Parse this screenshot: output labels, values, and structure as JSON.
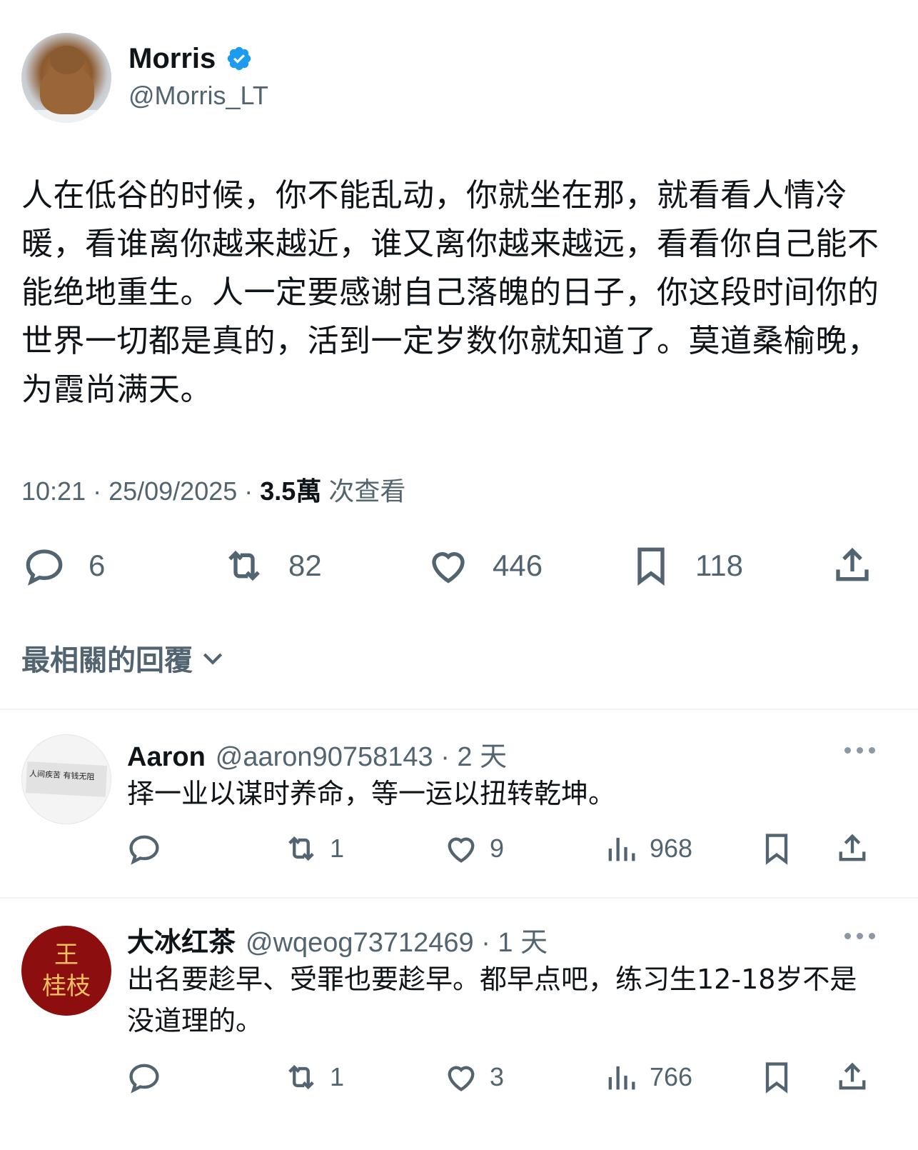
{
  "tweet": {
    "author": {
      "name": "Morris",
      "handle": "@Morris_LT",
      "verified": true
    },
    "text": "人在低谷的时候，你不能乱动，你就坐在那，就看看人情冷暖，看谁离你越来越近，谁又离你越来越远，看看你自己能不能绝地重生。人一定要感谢自己落魄的日子，你这段时间你的世界一切都是真的，活到一定岁数你就知道了。莫道桑榆晚，为霞尚满天。",
    "meta": {
      "time": "10:21",
      "sep1": " · ",
      "date": "25/09/2025",
      "sep2": " · ",
      "views_count": "3.5萬",
      "views_label": " 次查看"
    },
    "actions": {
      "replies": "6",
      "reposts": "82",
      "likes": "446",
      "bookmarks": "118"
    }
  },
  "sort_label": "最相關的回覆",
  "replies": [
    {
      "name": "Aaron",
      "handle": "@aaron90758143 · 2 天",
      "avatar_text": "人间疾苦 有钱无阻",
      "text": "择一业以谋时养命，等一运以扭转乾坤。",
      "reposts": "1",
      "likes": "9",
      "views": "968"
    },
    {
      "name": "大冰红茶",
      "handle": "@wqeog73712469 · 1 天",
      "avatar_text_1": "王",
      "avatar_text_2": "桂枝",
      "text": "出名要趁早、受罪也要趁早。都早点吧，练习生12-18岁不是没道理的。",
      "reposts": "1",
      "likes": "3",
      "views": "766"
    }
  ],
  "colors": {
    "text": "#0f1419",
    "secondary": "#536471",
    "verified": "#1d9bf0",
    "divider": "#eff3f4"
  },
  "icons": [
    "verified-badge-icon",
    "reply-icon",
    "repost-icon",
    "like-icon",
    "bookmark-icon",
    "share-icon",
    "views-icon",
    "more-icon",
    "chevron-down-icon"
  ]
}
